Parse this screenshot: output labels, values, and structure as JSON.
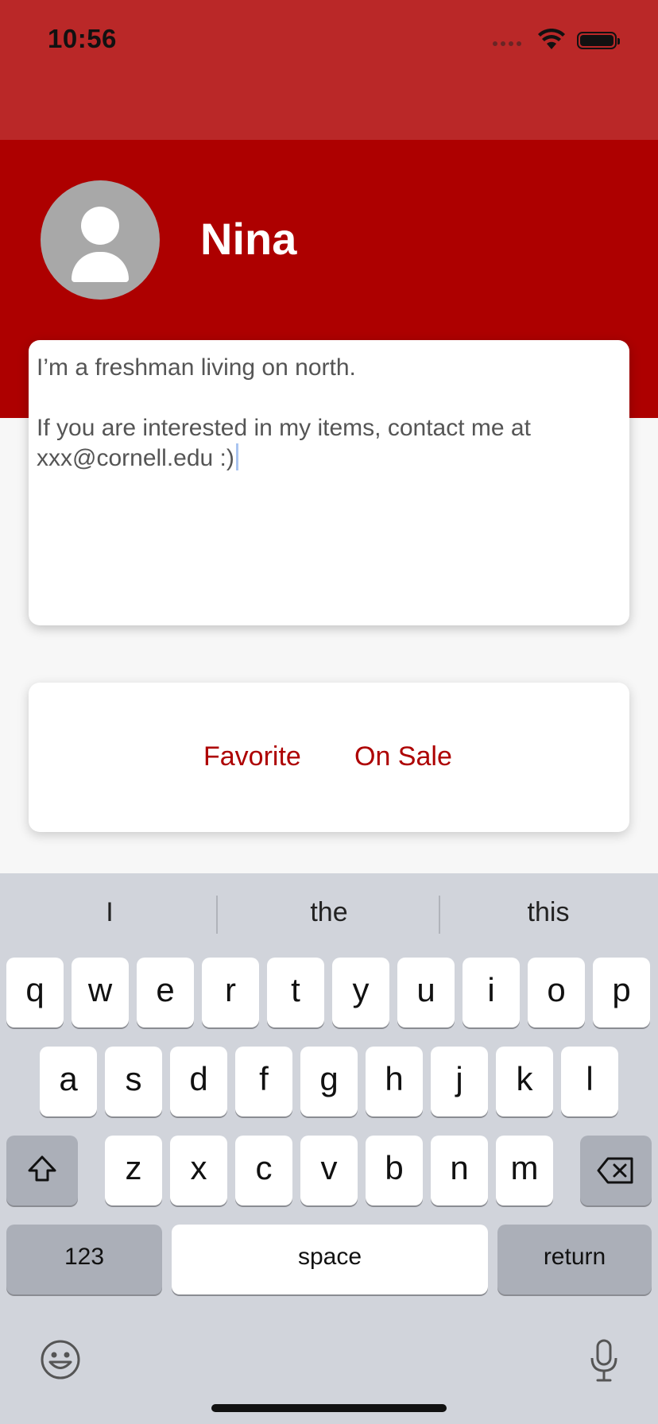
{
  "status_bar": {
    "time": "10:56"
  },
  "profile": {
    "name": "Nina"
  },
  "bio": {
    "text": "I’m a freshman living on north.\n\nIf you are interested in my items, contact me at xxx@cornell.edu :)"
  },
  "tabs": [
    {
      "label": "Favorite"
    },
    {
      "label": "On Sale"
    }
  ],
  "keyboard": {
    "suggestions": [
      "I",
      "the",
      "this"
    ],
    "row1": [
      "q",
      "w",
      "e",
      "r",
      "t",
      "y",
      "u",
      "i",
      "o",
      "p"
    ],
    "row2": [
      "a",
      "s",
      "d",
      "f",
      "g",
      "h",
      "j",
      "k",
      "l"
    ],
    "row3": [
      "z",
      "x",
      "c",
      "v",
      "b",
      "n",
      "m"
    ],
    "numbers_label": "123",
    "space_label": "space",
    "return_label": "return"
  },
  "colors": {
    "status_bar": "#ba2828",
    "header": "#ad0000",
    "accent": "#ad0000",
    "avatar": "#a8a8a8",
    "keyboard": "#d1d4db"
  },
  "icons": {
    "wifi": "wifi-icon",
    "battery": "battery-icon",
    "avatar": "person-icon",
    "shift": "shift-icon",
    "backspace": "backspace-icon",
    "emoji": "emoji-icon",
    "mic": "microphone-icon"
  }
}
